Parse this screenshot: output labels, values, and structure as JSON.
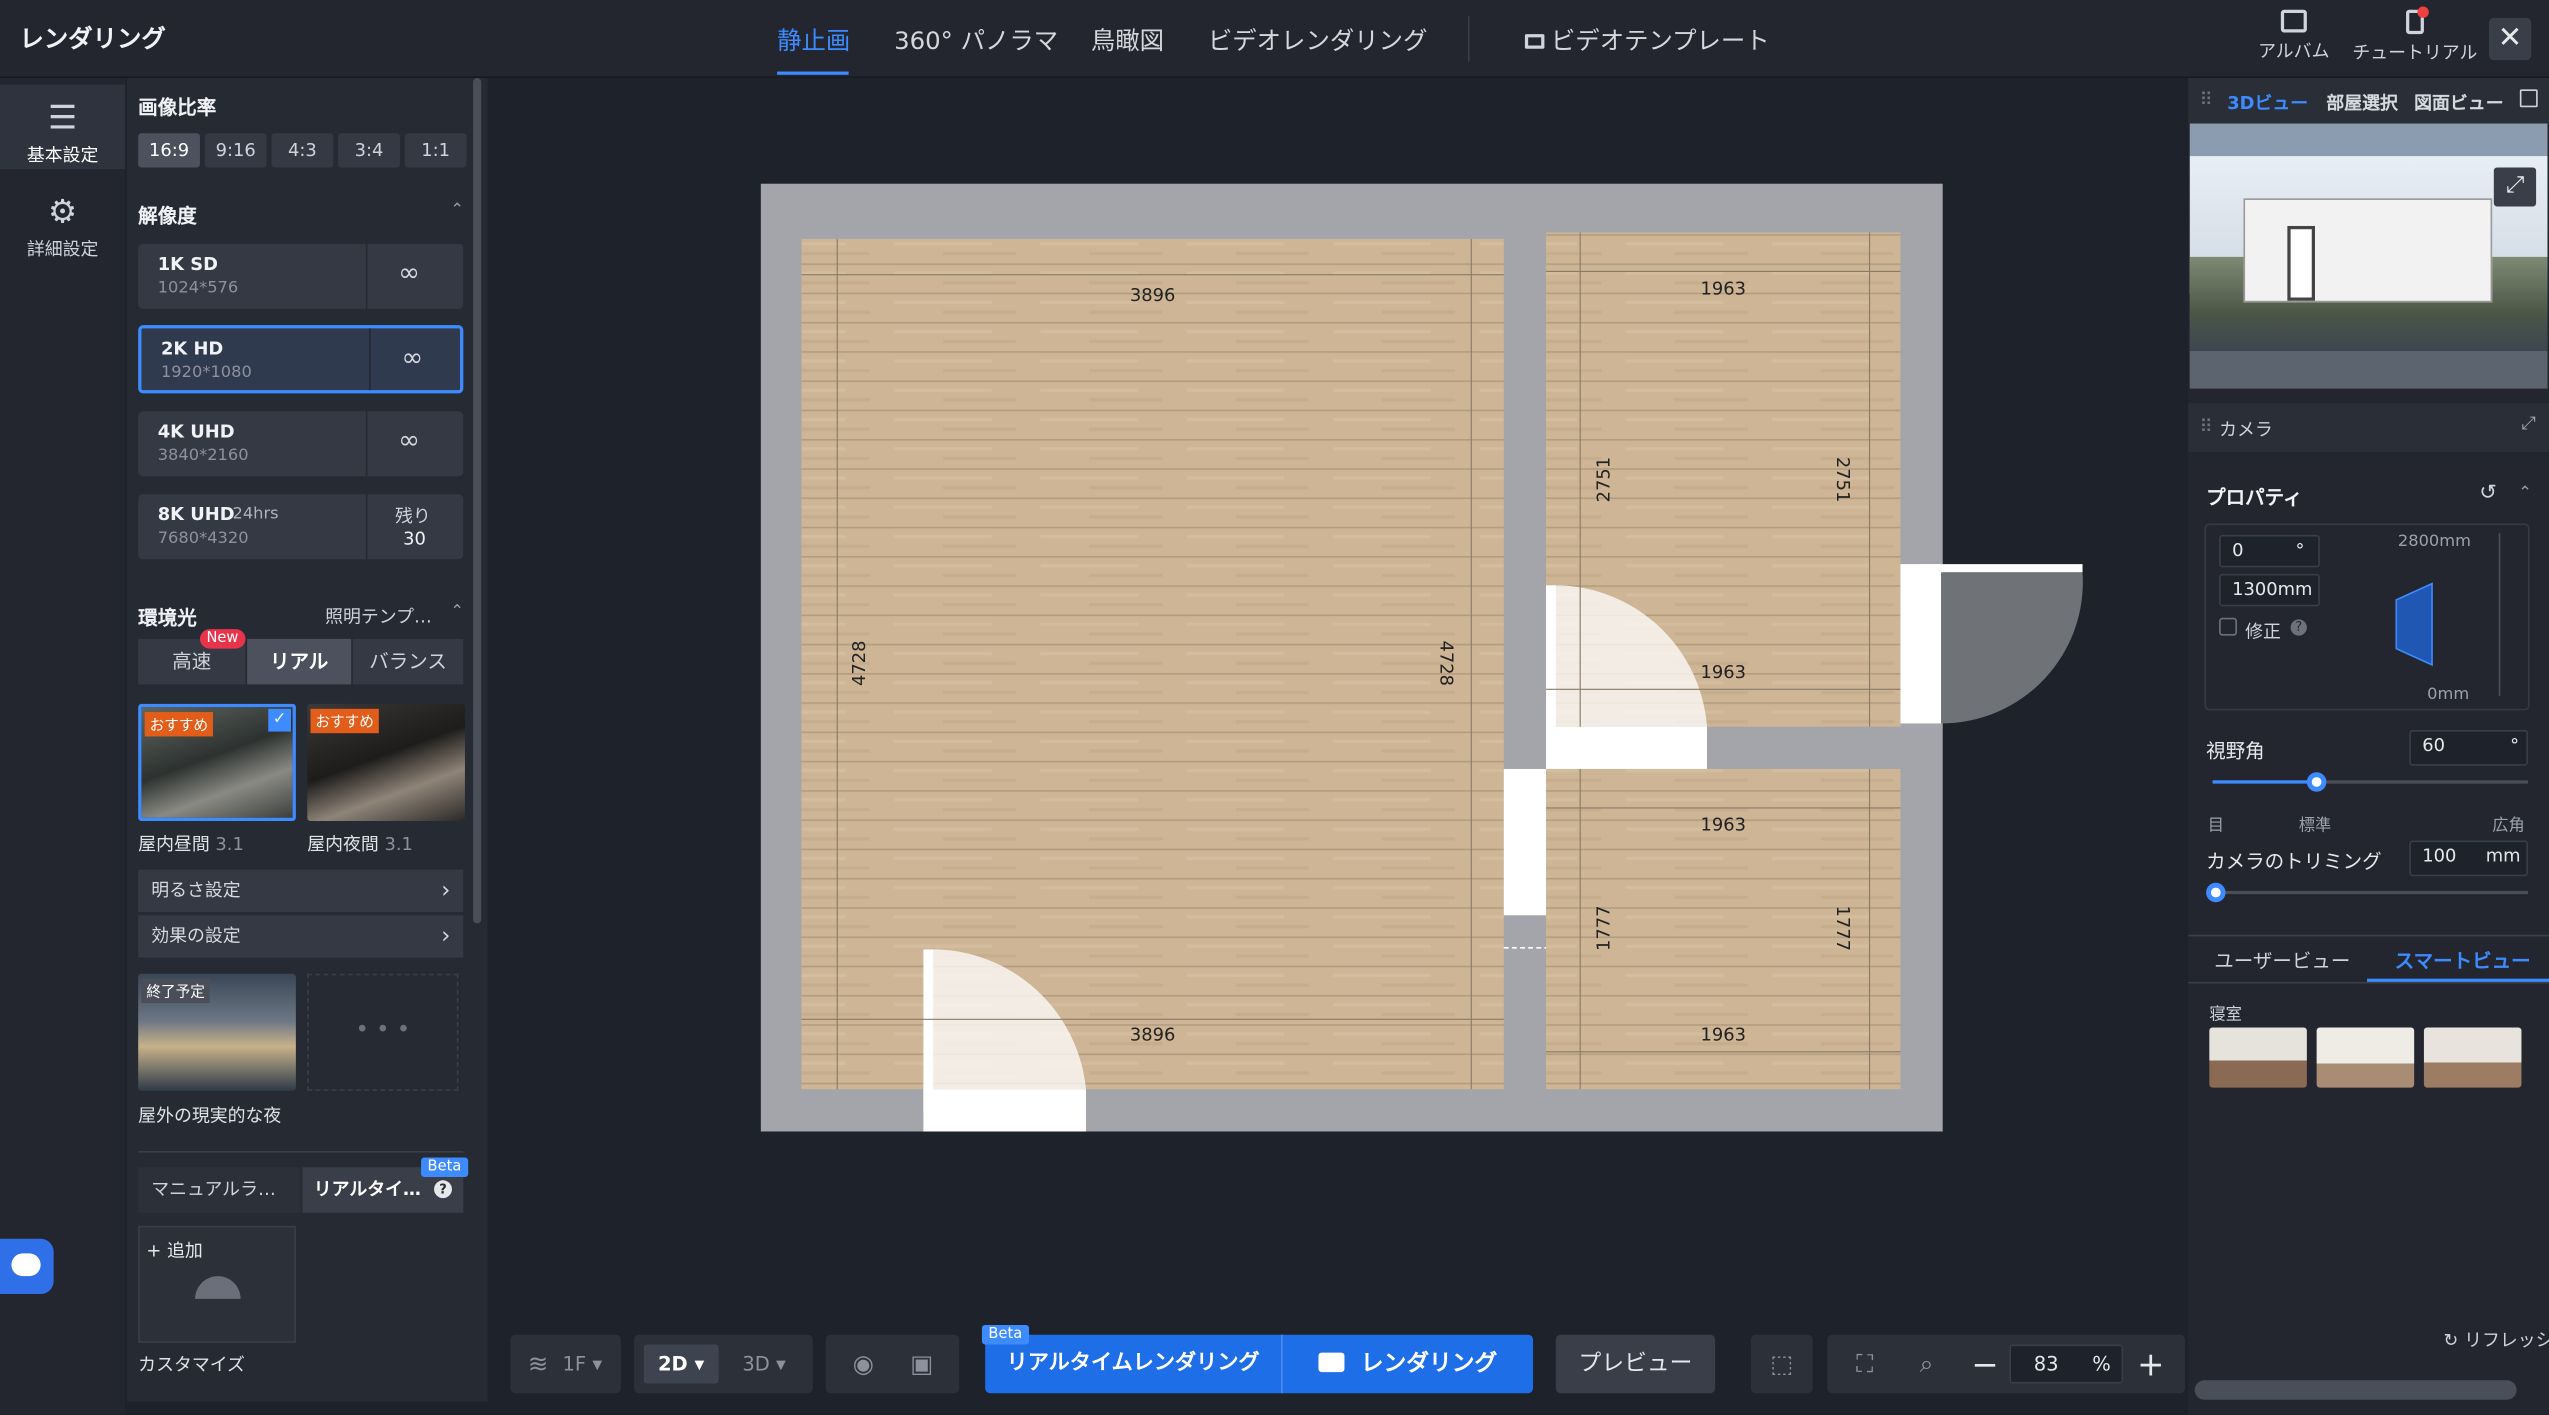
{
  "app": {
    "title": "レンダリング"
  },
  "top_tabs": [
    {
      "label": "静止画",
      "active": true
    },
    {
      "label": "360° パノラマ",
      "active": false
    },
    {
      "label": "鳥瞰図",
      "active": false
    },
    {
      "label": "ビデオレンダリング",
      "active": false
    },
    {
      "label": "ビデオテンプレート",
      "active": false
    }
  ],
  "top_right": {
    "album": "アルバム",
    "tutorial": "チュートリアル"
  },
  "rail": {
    "basic": "基本設定",
    "advanced": "詳細設定"
  },
  "left": {
    "ratio_title": "画像比率",
    "ratios": [
      "16:9",
      "9:16",
      "4:3",
      "3:4",
      "1:1"
    ],
    "ratio_selected": "16:9",
    "resolution_title": "解像度",
    "resolutions": [
      {
        "name": "1K SD",
        "size": "1024*576"
      },
      {
        "name": "2K HD",
        "size": "1920*1080"
      },
      {
        "name": "4K UHD",
        "size": "3840*2160"
      },
      {
        "name": "8K UHD",
        "tag": "24hrs",
        "size": "7680*4320",
        "remain_label": "残り",
        "remain": "30"
      }
    ],
    "resolution_selected": "2K HD",
    "env_title": "環境光",
    "env_template": "照明テンプ…",
    "env_modes": [
      "高速",
      "リアル",
      "バランス"
    ],
    "env_mode_selected": "リアル",
    "new_badge": "New",
    "presets": [
      {
        "tag": "おすすめ",
        "name": "屋内昼間",
        "version": "3.1",
        "selected": true
      },
      {
        "tag": "おすすめ",
        "name": "屋内夜間",
        "version": "3.1",
        "selected": false
      }
    ],
    "brightness": "明るさ設定",
    "effect": "効果の設定",
    "outdoor": {
      "tag": "終了予定",
      "name": "屋外の現実的な夜"
    },
    "light_tabs": [
      "マニュアルラ…",
      "リアルタイ…"
    ],
    "beta": "Beta",
    "add_label": "+ 追加",
    "customize": "カスタマイズ"
  },
  "floorplan": {
    "dims": [
      "3896",
      "3896",
      "4728",
      "4728",
      "1963",
      "1963",
      "1963",
      "1963",
      "2751",
      "2751",
      "1777",
      "1777"
    ]
  },
  "bottom": {
    "floor": "1F",
    "mode_2d": "2D",
    "mode_3d": "3D",
    "beta": "Beta",
    "realtime": "リアルタイムレンダリング",
    "render": "レンダリング",
    "preview": "プレビュー",
    "zoom": "83",
    "zoom_unit": "%"
  },
  "right": {
    "tabs": [
      "3Dビュー",
      "部屋選択",
      "図面ビュー"
    ],
    "tab_active": "3Dビュー",
    "camera": "カメラ",
    "property": "プロパティ",
    "angle": "0",
    "angle_unit": "°",
    "height": "1300mm",
    "max_h": "2800mm",
    "min_h": "0mm",
    "fix": "修正",
    "fov_label": "視野角",
    "fov": "60",
    "fov_unit": "°",
    "fov_ticks": [
      "目",
      "標準",
      "広角"
    ],
    "fov_level": 0.33,
    "trim_label": "カメラのトリミング",
    "trim": "100",
    "trim_unit": "mm",
    "view_tabs": [
      "ユーザービュー",
      "スマートビュー"
    ],
    "view_active": "スマートビュー",
    "room": "寝室",
    "refresh": "リフレッシ"
  }
}
